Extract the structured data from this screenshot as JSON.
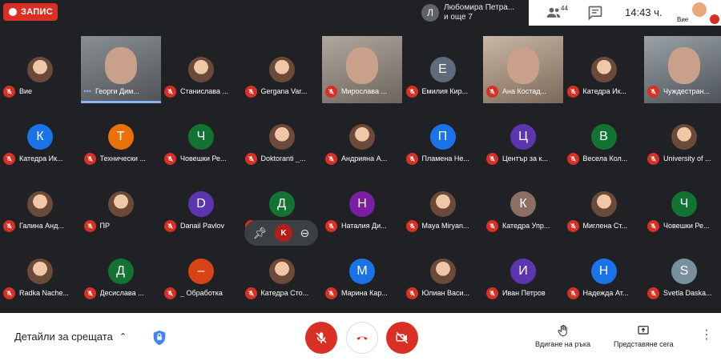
{
  "recording": {
    "label": "ЗАПИС"
  },
  "presenter": {
    "initial": "Л",
    "line1": "Любомира Петра...",
    "line2": "и още 7"
  },
  "participants_count": "44",
  "clock": "14:43 ч.",
  "self_label": "Вие",
  "tiles": [
    {
      "name": "Вие",
      "kind": "photo",
      "color": ""
    },
    {
      "name": "Георги Дим...",
      "kind": "video",
      "color": "",
      "speaking": true
    },
    {
      "name": "Станислава ...",
      "kind": "photo",
      "color": ""
    },
    {
      "name": "Gergana Var...",
      "kind": "photo",
      "color": ""
    },
    {
      "name": "Мирослава ...",
      "kind": "video",
      "color": ""
    },
    {
      "name": "Емилия Кир...",
      "kind": "letter",
      "letter": "Е",
      "color": "#5f6b7a"
    },
    {
      "name": "Ана Костад...",
      "kind": "video",
      "color": ""
    },
    {
      "name": "Катедра Ик...",
      "kind": "photo",
      "color": ""
    },
    {
      "name": "Чуждестран...",
      "kind": "video",
      "color": ""
    },
    {
      "name": "Катедра Ик...",
      "kind": "letter",
      "letter": "К",
      "color": "#1a73e8"
    },
    {
      "name": "Технически ...",
      "kind": "letter",
      "letter": "Т",
      "color": "#e8710a"
    },
    {
      "name": "Човешки Ре...",
      "kind": "letter",
      "letter": "Ч",
      "color": "#137333"
    },
    {
      "name": "Doktoranti _...",
      "kind": "photo",
      "color": ""
    },
    {
      "name": "Андрияна А...",
      "kind": "photo",
      "color": ""
    },
    {
      "name": "Пламена Не...",
      "kind": "letter",
      "letter": "П",
      "color": "#1a73e8"
    },
    {
      "name": "Център за к...",
      "kind": "letter",
      "letter": "Ц",
      "color": "#5e35b1"
    },
    {
      "name": "Весела Кол...",
      "kind": "letter",
      "letter": "В",
      "color": "#137333"
    },
    {
      "name": "University of ...",
      "kind": "photo",
      "color": ""
    },
    {
      "name": "Галина Анд...",
      "kind": "photo",
      "color": ""
    },
    {
      "name": "ПР",
      "kind": "photo",
      "color": ""
    },
    {
      "name": "Danail Pavlov",
      "kind": "letter",
      "letter": "D",
      "color": "#5e35b1"
    },
    {
      "name": "Деница Кар...",
      "kind": "letter",
      "letter": "Д",
      "color": "#137333"
    },
    {
      "name": "Наталия Ди...",
      "kind": "letter",
      "letter": "Н",
      "color": "#7b1fa2"
    },
    {
      "name": "Maya Miryan...",
      "kind": "photo",
      "color": ""
    },
    {
      "name": "Катедра Упр...",
      "kind": "letter",
      "letter": "К",
      "color": "#8d6e63"
    },
    {
      "name": "Миглена Ст...",
      "kind": "photo",
      "color": ""
    },
    {
      "name": "Човешки Ре...",
      "kind": "letter",
      "letter": "Ч",
      "color": "#137333"
    },
    {
      "name": "Radka Nache...",
      "kind": "photo",
      "color": ""
    },
    {
      "name": "Десислава ...",
      "kind": "letter",
      "letter": "Д",
      "color": "#137333"
    },
    {
      "name": "_ Обработка",
      "kind": "letter",
      "letter": "–",
      "color": "#d84315"
    },
    {
      "name": "Катедра Сто...",
      "kind": "photo",
      "color": ""
    },
    {
      "name": "Марина Кар...",
      "kind": "letter",
      "letter": "М",
      "color": "#1a73e8"
    },
    {
      "name": "Юлиан Васи...",
      "kind": "photo",
      "color": ""
    },
    {
      "name": "Иван Петров",
      "kind": "letter",
      "letter": "И",
      "color": "#5e35b1"
    },
    {
      "name": "Надежда Ат...",
      "kind": "letter",
      "letter": "Н",
      "color": "#1a73e8"
    },
    {
      "name": "Svetla Daska...",
      "kind": "letter",
      "letter": "S",
      "color": "#78909c"
    }
  ],
  "bottom": {
    "details_label": "Детайли за срещата",
    "raise_hand_label": "Вдигане на ръка",
    "present_label": "Представяне сега"
  }
}
